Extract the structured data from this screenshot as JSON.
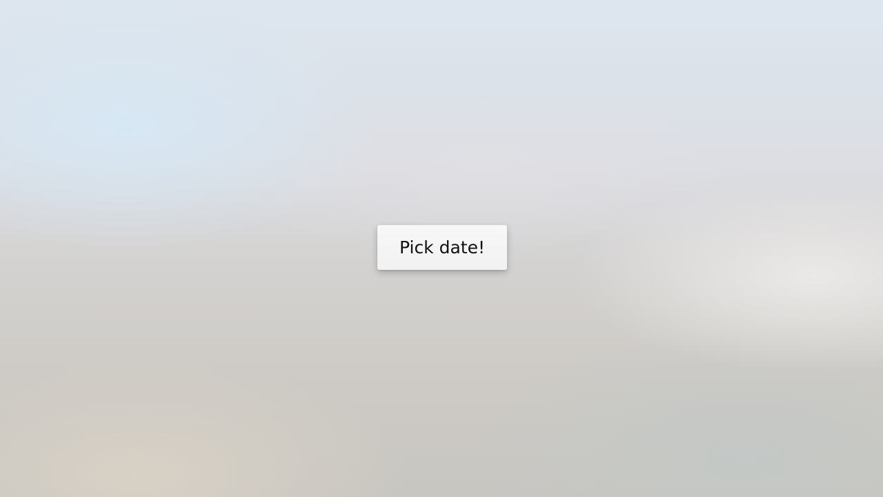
{
  "main": {
    "pick_date_button": {
      "label": "Pick date!"
    }
  },
  "colors": {
    "button_background": "#f4f4f4",
    "button_text": "#111111",
    "backdrop_top": "#dde6ef",
    "backdrop_bottom": "#c8c6c1"
  }
}
